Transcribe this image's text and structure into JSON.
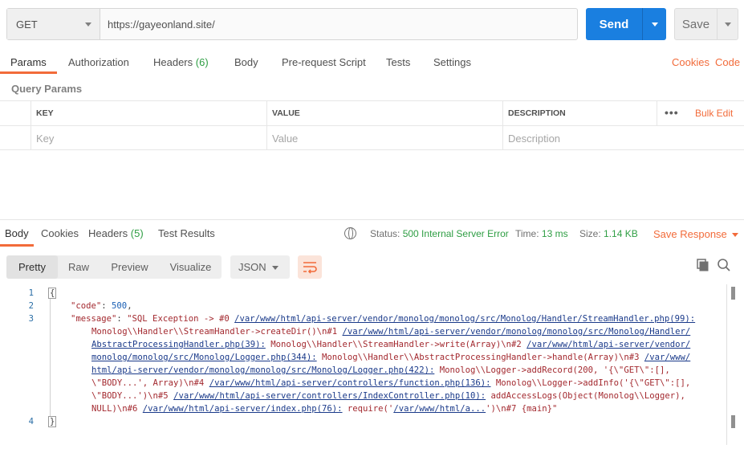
{
  "request": {
    "method": "GET",
    "url": "https://gayeonland.site/",
    "send_label": "Send",
    "save_label": "Save"
  },
  "request_tabs": [
    {
      "label": "Params",
      "active": true
    },
    {
      "label": "Authorization"
    },
    {
      "label": "Headers",
      "count": "(6)"
    },
    {
      "label": "Body"
    },
    {
      "label": "Pre-request Script"
    },
    {
      "label": "Tests"
    },
    {
      "label": "Settings"
    }
  ],
  "links": {
    "cookies": "Cookies",
    "code": "Code"
  },
  "query_params": {
    "title": "Query Params",
    "columns": [
      "KEY",
      "VALUE",
      "DESCRIPTION"
    ],
    "more": "•••",
    "bulk_edit": "Bulk Edit",
    "placeholders": {
      "key": "Key",
      "value": "Value",
      "description": "Description"
    }
  },
  "response_tabs": [
    {
      "label": "Body",
      "active": true
    },
    {
      "label": "Cookies"
    },
    {
      "label": "Headers",
      "count": "(5)"
    },
    {
      "label": "Test Results"
    }
  ],
  "response_meta": {
    "status_label": "Status:",
    "status_value": "500 Internal Server Error",
    "time_label": "Time:",
    "time_value": "13 ms",
    "size_label": "Size:",
    "size_value": "1.14 KB",
    "save_response": "Save Response"
  },
  "view_modes": [
    "Pretty",
    "Raw",
    "Preview",
    "Visualize"
  ],
  "format": "JSON",
  "icons": {
    "globe": "globe-icon",
    "wrap": "wrap-lines-icon",
    "copy": "copy-icon",
    "search": "search-icon"
  },
  "colors": {
    "accent": "#f26b3a",
    "send": "#1a7fe0",
    "success": "#2f9e44"
  },
  "code": {
    "line_numbers": [
      "1",
      "2",
      "3",
      "4"
    ],
    "open_brace": "{",
    "close_brace": "}",
    "code_key": "\"code\"",
    "code_value": "500",
    "message_key": "\"message\"",
    "msg": {
      "s1": "\"SQL Exception -> #0 ",
      "l1": "/var/www/html/api-server/vendor/monolog/monolog/src/Monolog/Handler/StreamHandler.php(99):",
      "s2": "Monolog\\\\Handler\\\\StreamHandler->createDir()\\n#1 ",
      "l2a": "/var/www/html/api-server/vendor/monolog/monolog/src/Monolog/Handler/",
      "l2b": "AbstractProcessingHandler.php(39):",
      "s3": " Monolog\\\\Handler\\\\StreamHandler->write(Array)\\n#2 ",
      "l3a": "/var/www/html/api-server/vendor/",
      "l3b": "monolog/monolog/src/Monolog/Logger.php(344):",
      "s4": " Monolog\\\\Handler\\\\AbstractProcessingHandler->handle(Array)\\n#3 ",
      "l4a": "/var/www/",
      "l4b": "html/api-server/vendor/monolog/monolog/src/Monolog/Logger.php(422):",
      "s5": " Monolog\\\\Logger->addRecord(200, '{\\\"GET\\\":[],",
      "s6": "\\\"BODY...', Array)\\n#4 ",
      "l6": "/var/www/html/api-server/controllers/function.php(136):",
      "s6b": " Monolog\\\\Logger->addInfo('{\\\"GET\\\":[],",
      "s7": "\\\"BODY...')\\n#5 ",
      "l7": "/var/www/html/api-server/controllers/IndexController.php(10):",
      "s7b": " addAccessLogs(Object(Monolog\\\\Logger),",
      "s8": "NULL)\\n#6 ",
      "l8": "/var/www/html/api-server/index.php(76):",
      "s8b": " require('",
      "l8b": "/var/www/html/a...",
      "s8c": "')\\n#7 {main}\""
    }
  }
}
